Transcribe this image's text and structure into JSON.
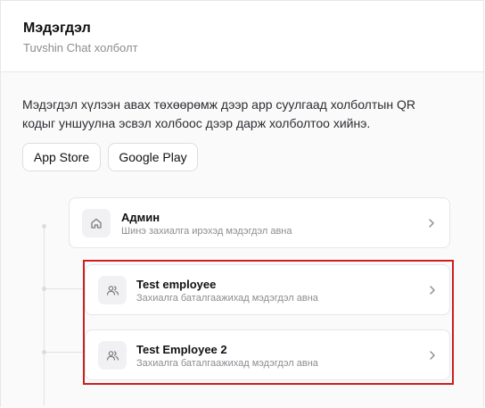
{
  "header": {
    "title": "Мэдэгдэл",
    "subtitle": "Tuvshin Chat холболт"
  },
  "intro": {
    "description": "Мэдэгдэл хүлээн авах төхөөрөмж дээр app суулгаад холболтын QR кодыг уншуулна эсвэл холбоос дээр дарж холболтоо хийнэ."
  },
  "store_buttons": {
    "app_store": "App Store",
    "google_play": "Google Play"
  },
  "recipients": [
    {
      "name": "Админ",
      "description": "Шинэ захиалга ирэхэд мэдэгдэл авна",
      "icon": "home-icon"
    },
    {
      "name": "Test employee",
      "description": "Захиалга баталгаажихад мэдэгдэл авна",
      "icon": "users-icon"
    },
    {
      "name": "Test Employee 2",
      "description": "Захиалга баталгаажихад мэдэгдэл авна",
      "icon": "users-icon"
    }
  ],
  "colors": {
    "highlight": "#cc1f1f",
    "text_primary": "#111111",
    "text_secondary": "#8d8d93"
  }
}
